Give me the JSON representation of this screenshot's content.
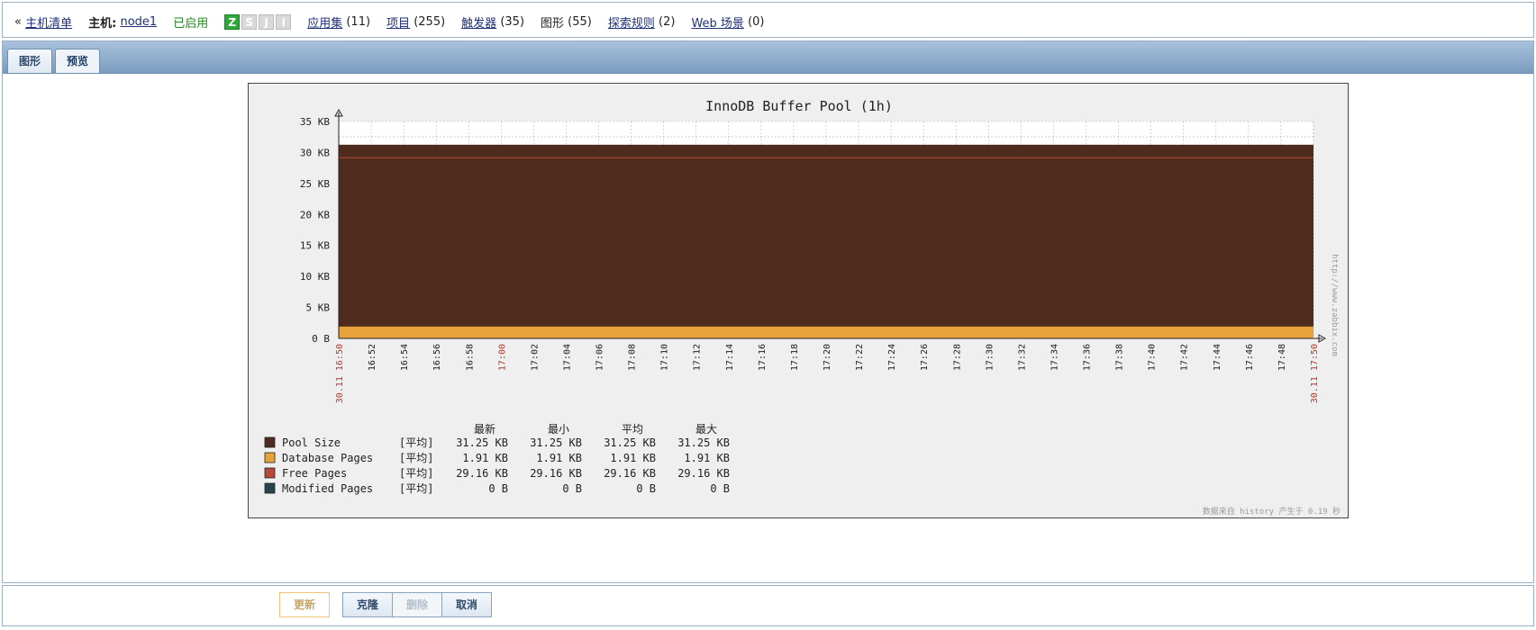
{
  "header": {
    "back_arrow": "«",
    "host_list": "主机清单",
    "host_label": "主机:",
    "host_name": "node1",
    "status": "已启用",
    "availability": [
      "Z",
      "S",
      "J",
      "I"
    ],
    "links": [
      {
        "label": "应用集",
        "count": "(11)",
        "is_link": true
      },
      {
        "label": "项目",
        "count": "(255)",
        "is_link": true
      },
      {
        "label": "触发器",
        "count": "(35)",
        "is_link": true
      },
      {
        "label": "图形",
        "count": "(55)",
        "is_link": false
      },
      {
        "label": "探索规则",
        "count": "(2)",
        "is_link": true
      },
      {
        "label": "Web 场景",
        "count": "(0)",
        "is_link": true
      }
    ]
  },
  "tabs": [
    {
      "label": "图形",
      "active": false
    },
    {
      "label": "预览",
      "active": true
    }
  ],
  "chart_data": {
    "type": "area",
    "title": "InnoDB Buffer Pool (1h)",
    "y_unit": "KB",
    "ylim": [
      0,
      35
    ],
    "y_ticks": [
      "0 B",
      "5 KB",
      "10 KB",
      "15 KB",
      "20 KB",
      "25 KB",
      "30 KB",
      "35 KB"
    ],
    "x_start_label": "30.11 16:50",
    "x_end_label": "30.11 17:50",
    "x_ticks": [
      "16:52",
      "16:54",
      "16:56",
      "16:58",
      "17:00",
      "17:02",
      "17:04",
      "17:06",
      "17:08",
      "17:10",
      "17:12",
      "17:14",
      "17:16",
      "17:18",
      "17:20",
      "17:22",
      "17:24",
      "17:26",
      "17:28",
      "17:30",
      "17:32",
      "17:34",
      "17:36",
      "17:38",
      "17:40",
      "17:42",
      "17:44",
      "17:46",
      "17:48"
    ],
    "x_highlight_ticks": [
      "17:00"
    ],
    "grid": true,
    "legend_headers": [
      "最新",
      "最小",
      "平均",
      "最大"
    ],
    "series": [
      {
        "name": "Pool Size",
        "func": "[平均]",
        "color": "#4f2b1d",
        "value_kb": 31.25,
        "stats": [
          "31.25 KB",
          "31.25 KB",
          "31.25 KB",
          "31.25 KB"
        ]
      },
      {
        "name": "Database Pages",
        "func": "[平均]",
        "color": "#e8a23b",
        "value_kb": 1.91,
        "stats": [
          "1.91 KB",
          "1.91 KB",
          "1.91 KB",
          "1.91 KB"
        ]
      },
      {
        "name": "Free Pages",
        "func": "[平均]",
        "color": "#b4483a",
        "value_kb": 29.16,
        "stats": [
          "29.16 KB",
          "29.16 KB",
          "29.16 KB",
          "29.16 KB"
        ]
      },
      {
        "name": "Modified Pages",
        "func": "[平均]",
        "color": "#24444d",
        "value_kb": 0,
        "stats": [
          "0 B",
          "0 B",
          "0 B",
          "0 B"
        ]
      }
    ],
    "side_watermark": "http://www.zabbix.com",
    "footer_note": "数据来自 history  产生于 0.19 秒"
  },
  "buttons": {
    "update": "更新",
    "clone": "克隆",
    "delete": "删除",
    "cancel": "取消"
  }
}
